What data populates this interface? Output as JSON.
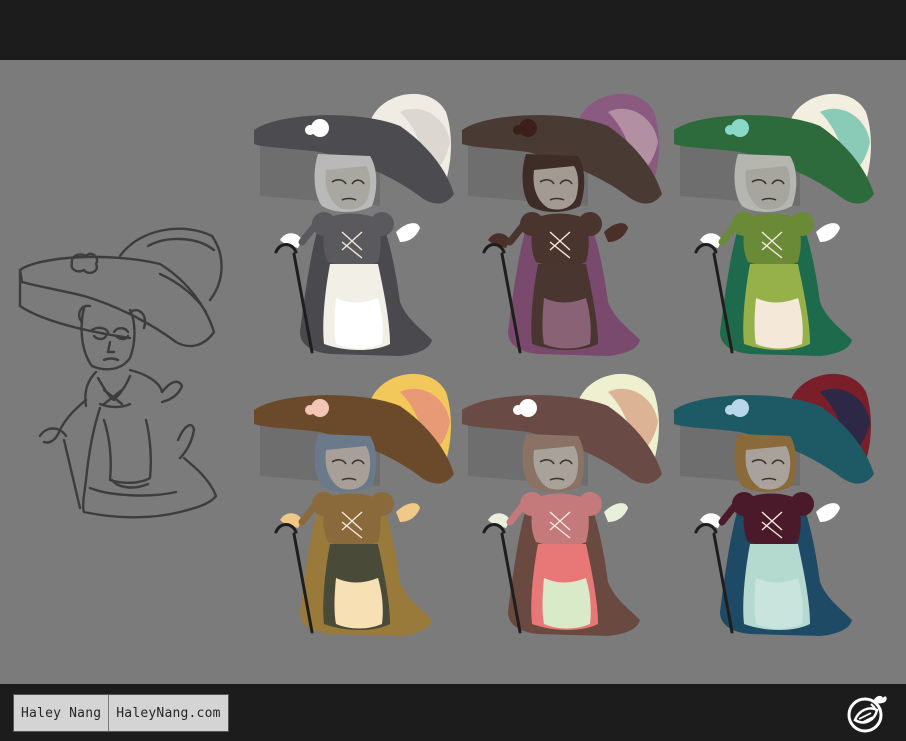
{
  "footer": {
    "artist_name": "Haley Nang",
    "website": "HaleyNang.com",
    "logo_icon": "radish-logo-icon"
  },
  "sketch": {
    "name": "line-sketch",
    "stroke": "#3d3d3d"
  },
  "variants": [
    {
      "name": "grey-white",
      "hat": "#4c4c50",
      "feather": "#f0ece4",
      "feather2": "#d8d4cc",
      "hair": "#b9b9b9",
      "skin": "#a8a8a0",
      "robe": "#4a4a4e",
      "bodice": "#5a5a5e",
      "skirt": "#f2efe6",
      "apron": "#ffffff",
      "rose": "#ffffff",
      "glove": "#ffffff"
    },
    {
      "name": "mauve-brown",
      "hat": "#4a3a34",
      "feather": "#8a5a80",
      "feather2": "#b89aa8",
      "hair": "#3e2c26",
      "skin": "#a49a94",
      "robe": "#7a4a6e",
      "bodice": "#4a342e",
      "skirt": "#4a3630",
      "apron": "#8a6276",
      "rose": "#3a2018",
      "glove": "#4a3028"
    },
    {
      "name": "green-cream",
      "hat": "#2e6b3c",
      "feather": "#f2efe0",
      "feather2": "#78c4b0",
      "hair": "#b6b6b0",
      "skin": "#a6a69e",
      "robe": "#1e6a4c",
      "bodice": "#6a8a38",
      "skirt": "#96b04a",
      "apron": "#f4e8d8",
      "rose": "#8ad8c8",
      "glove": "#ffffff"
    },
    {
      "name": "olive-peach",
      "hat": "#6a4a2a",
      "feather": "#f2c85a",
      "feather2": "#e6907a",
      "hair": "#6a7a8a",
      "skin": "#a8a098",
      "robe": "#9a7a3a",
      "bodice": "#8a6a3a",
      "skirt": "#4a4a38",
      "apron": "#f6e0b4",
      "rose": "#f4c4b4",
      "glove": "#f0c888"
    },
    {
      "name": "rose-mint",
      "hat": "#6a4a44",
      "feather": "#eef0d0",
      "feather2": "#d8a88a",
      "hair": "#8a7264",
      "skin": "#a8a29a",
      "robe": "#6a4a40",
      "bodice": "#c47a7a",
      "skirt": "#e87878",
      "apron": "#d8eac8",
      "rose": "#ffffff",
      "glove": "#e8f0dc"
    },
    {
      "name": "teal-crimson",
      "hat": "#1e5a66",
      "feather": "#7a1e2a",
      "feather2": "#1e2a4a",
      "hair": "#8a6a3a",
      "skin": "#a8a29a",
      "robe": "#1e4a66",
      "bodice": "#4a1a2a",
      "skirt": "#b4dad0",
      "apron": "#c8e4dc",
      "rose": "#b8d8e8",
      "glove": "#ffffff"
    }
  ]
}
